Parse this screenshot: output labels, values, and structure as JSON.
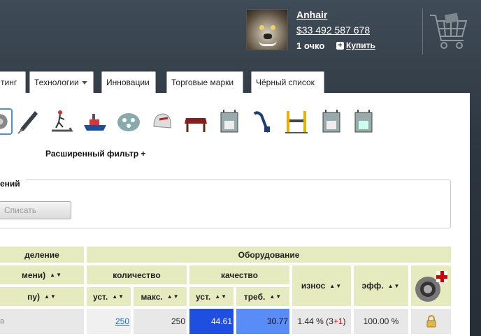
{
  "header": {
    "username": "Anhair",
    "money": "$33 492 587 678",
    "points": "1 очко",
    "buy_label": "Купить"
  },
  "nav": {
    "tabs": [
      {
        "label": "тинг"
      },
      {
        "label": "Технологии"
      },
      {
        "label": "Инновации"
      },
      {
        "label": "Торговые марки"
      },
      {
        "label": "Чёрный список"
      }
    ]
  },
  "toolbar": {
    "icons": [
      "gear-icon",
      "drill-icon",
      "treadmill-icon",
      "ship-icon",
      "film-reel-icon",
      "helmet-icon",
      "table-icon",
      "machine-icon",
      "fuel-pump-icon",
      "car-lift-icon",
      "machine-icon",
      "machine-icon"
    ]
  },
  "filter": {
    "advanced_label": "Расширенный фильтр +"
  },
  "fieldset": {
    "legend": "ений",
    "write_off_label": "Списать"
  },
  "table": {
    "col_division": "деление",
    "col_equipment": "Оборудование",
    "col_name": "мени)",
    "col_quantity": "количество",
    "col_quality": "качество",
    "col_wear": "износ",
    "col_eff": "эфф.",
    "col_type": "пу)",
    "col_installed": "уст.",
    "col_max": "макс.",
    "col_q_installed": "уст.",
    "col_q_required": "треб.",
    "sort_glyph": "▲▼",
    "row": {
      "name": "а",
      "installed": "250",
      "max": "250",
      "q_installed": "44.61",
      "q_required": "30.77",
      "wear_main": "1.44 % (3",
      "wear_plus": "+1",
      "wear_close": ")",
      "eff": "100.00 %"
    }
  },
  "colors": {
    "header_bg": "#e6ebbf",
    "quality_installed": "#1f4fe0",
    "quality_required": "#5a8cf7"
  }
}
